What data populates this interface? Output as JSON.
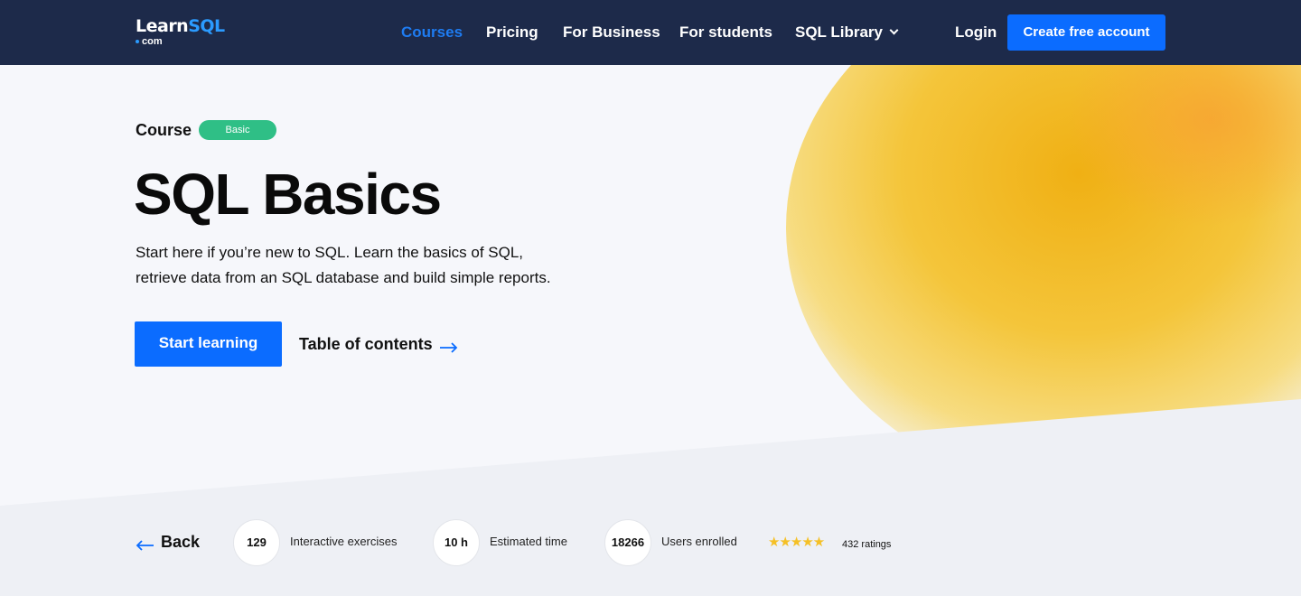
{
  "nav": {
    "logo_main_part1": "Learn",
    "logo_main_part2": "SQL",
    "logo_sub": "com",
    "links": [
      {
        "label": "Courses",
        "active": true
      },
      {
        "label": "Pricing"
      },
      {
        "label": "For Business"
      },
      {
        "label": "For students"
      },
      {
        "label": "SQL Library"
      }
    ],
    "login": "Login",
    "create_account": "Create free account"
  },
  "hero": {
    "course_label": "Course",
    "badge": "Basic",
    "title": "SQL Basics",
    "description": "Start here if you’re new to SQL. Learn the basics of SQL, retrieve data from an SQL database and build simple reports.",
    "start_button": "Start learning",
    "toc_link": "Table of contents"
  },
  "stats": {
    "back": "Back",
    "items": [
      {
        "value": "129",
        "label": "Interactive exercises"
      },
      {
        "value": "10 h",
        "label": "Estimated time"
      },
      {
        "value": "18266",
        "label": "Users enrolled"
      }
    ],
    "stars": "★★★★★",
    "rating_value": 5,
    "ratings": "432 ratings"
  },
  "colors": {
    "nav_bg": "#1d2a4a",
    "accent": "#0b6cff",
    "badge": "#2fbf86",
    "star": "#f5c026"
  }
}
